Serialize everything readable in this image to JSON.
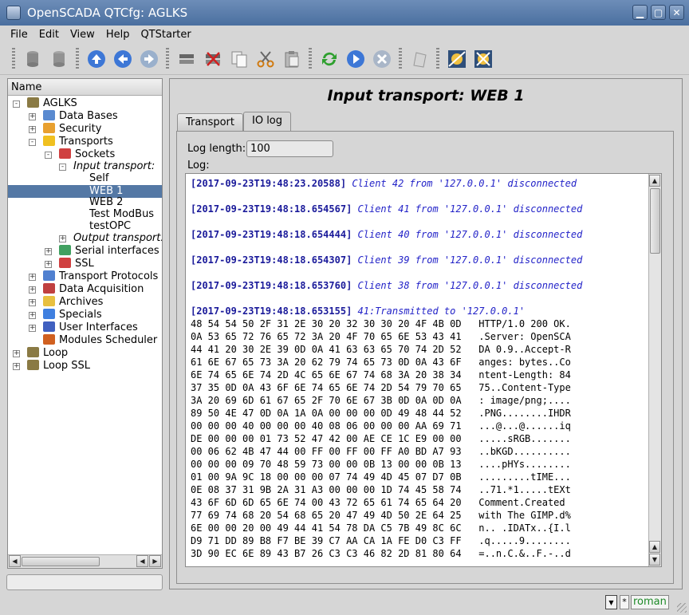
{
  "window": {
    "title": "OpenSCADA QTCfg: AGLKS",
    "min_glyph": "▁",
    "max_glyph": "▢",
    "close_glyph": "✕"
  },
  "menu": [
    "File",
    "Edit",
    "View",
    "Help",
    "QTStarter"
  ],
  "toolbar_icons": [
    "db-load-icon",
    "db-save-icon",
    "up-icon",
    "back-icon",
    "forward-icon",
    "item-add-icon",
    "item-delete-icon",
    "copy-icon",
    "cut-icon",
    "paste-icon",
    "refresh-icon",
    "start-icon",
    "stop-icon",
    "info-icon",
    "module-icon-1",
    "module-icon-2"
  ],
  "tree": {
    "header": "Name",
    "items": [
      {
        "label": "AGLKS",
        "color": "#8a7a44"
      },
      {
        "label": "Data Bases",
        "color": "#5a8ad0"
      },
      {
        "label": "Security",
        "color": "#e8a030"
      },
      {
        "label": "Transports",
        "color": "#f0c020"
      },
      {
        "label": "Sockets",
        "color": "#d04040"
      },
      {
        "label": "Input transport:"
      },
      {
        "label": "Self"
      },
      {
        "label": "WEB 1"
      },
      {
        "label": "WEB 2"
      },
      {
        "label": "Test ModBus"
      },
      {
        "label": "testOPC"
      },
      {
        "label": "Output transport:"
      },
      {
        "label": "Serial interfaces",
        "color": "#40a060"
      },
      {
        "label": "SSL",
        "color": "#d04040"
      },
      {
        "label": "Transport Protocols",
        "color": "#5080d0"
      },
      {
        "label": "Data Acquisition",
        "color": "#c04040"
      },
      {
        "label": "Archives",
        "color": "#e8c040"
      },
      {
        "label": "Specials",
        "color": "#4080e0"
      },
      {
        "label": "User Interfaces",
        "color": "#4060c0"
      },
      {
        "label": "Modules Scheduler",
        "color": "#d06020"
      },
      {
        "label": "Loop",
        "color": "#8a7a44"
      },
      {
        "label": "Loop SSL",
        "color": "#8a7a44"
      }
    ]
  },
  "page": {
    "title": "Input transport: WEB 1",
    "tabs": [
      "Transport",
      "IO log"
    ],
    "log_length_label": "Log length:",
    "log_length_value": "100",
    "log_label": "Log:"
  },
  "log": {
    "entries": [
      {
        "ts": "[2017-09-23T19:48:23.20588]",
        "msg": "Client 42 from '127.0.0.1' disconnected"
      },
      {
        "ts": "[2017-09-23T19:48:18.654567]",
        "msg": "Client 41 from '127.0.0.1' disconnected"
      },
      {
        "ts": "[2017-09-23T19:48:18.654444]",
        "msg": "Client 40 from '127.0.0.1' disconnected"
      },
      {
        "ts": "[2017-09-23T19:48:18.654307]",
        "msg": "Client 39 from '127.0.0.1' disconnected"
      },
      {
        "ts": "[2017-09-23T19:48:18.653760]",
        "msg": "Client 38 from '127.0.0.1' disconnected"
      },
      {
        "ts": "[2017-09-23T19:48:18.653155]",
        "msg": "41:Transmitted to '127.0.0.1'"
      }
    ],
    "hex_lines": [
      {
        "hex": "48 54 54 50 2F 31 2E 30 20 32 30 30 20 4F 4B 0D",
        "ascii": "HTTP/1.0 200 OK."
      },
      {
        "hex": "0A 53 65 72 76 65 72 3A 20 4F 70 65 6E 53 43 41",
        "ascii": ".Server: OpenSCA"
      },
      {
        "hex": "44 41 20 30 2E 39 0D 0A 41 63 63 65 70 74 2D 52",
        "ascii": "DA 0.9..Accept-R"
      },
      {
        "hex": "61 6E 67 65 73 3A 20 62 79 74 65 73 0D 0A 43 6F",
        "ascii": "anges: bytes..Co"
      },
      {
        "hex": "6E 74 65 6E 74 2D 4C 65 6E 67 74 68 3A 20 38 34",
        "ascii": "ntent-Length: 84"
      },
      {
        "hex": "37 35 0D 0A 43 6F 6E 74 65 6E 74 2D 54 79 70 65",
        "ascii": "75..Content-Type"
      },
      {
        "hex": "3A 20 69 6D 61 67 65 2F 70 6E 67 3B 0D 0A 0D 0A",
        "ascii": ": image/png;...."
      },
      {
        "hex": "89 50 4E 47 0D 0A 1A 0A 00 00 00 0D 49 48 44 52",
        "ascii": ".PNG........IHDR"
      },
      {
        "hex": "00 00 00 40 00 00 00 40 08 06 00 00 00 AA 69 71",
        "ascii": "...@...@......iq"
      },
      {
        "hex": "DE 00 00 00 01 73 52 47 42 00 AE CE 1C E9 00 00",
        "ascii": ".....sRGB......."
      },
      {
        "hex": "00 06 62 4B 47 44 00 FF 00 FF 00 FF A0 BD A7 93",
        "ascii": "..bKGD.........."
      },
      {
        "hex": "00 00 00 09 70 48 59 73 00 00 0B 13 00 00 0B 13",
        "ascii": "....pHYs........"
      },
      {
        "hex": "01 00 9A 9C 18 00 00 00 07 74 49 4D 45 07 D7 0B",
        "ascii": ".........tIME..."
      },
      {
        "hex": "0E 08 37 31 9B 2A 31 A3 00 00 00 1D 74 45 58 74",
        "ascii": "..71.*1.....tEXt"
      },
      {
        "hex": "43 6F 6D 6D 65 6E 74 00 43 72 65 61 74 65 64 20",
        "ascii": "Comment.Created "
      },
      {
        "hex": "77 69 74 68 20 54 68 65 20 47 49 4D 50 2E 64 25",
        "ascii": "with The GIMP.d%"
      },
      {
        "hex": "6E 00 00 20 00 49 44 41 54 78 DA C5 7B 49 8C 6C",
        "ascii": "n.. .IDATx..{I.l"
      },
      {
        "hex": "D9 71 DD 89 B8 F7 BE 39 C7 AA CA 1A FE D0 C3 FF",
        "ascii": ".q.....9........"
      },
      {
        "hex": "3D 90 EC 6E 89 43 B7 26 C3 C3 46 82 2D 81 80 64",
        "ascii": "=..n.C.&..F.-..d"
      }
    ]
  },
  "statusbar": {
    "user_mark": "*",
    "user": "roman"
  }
}
